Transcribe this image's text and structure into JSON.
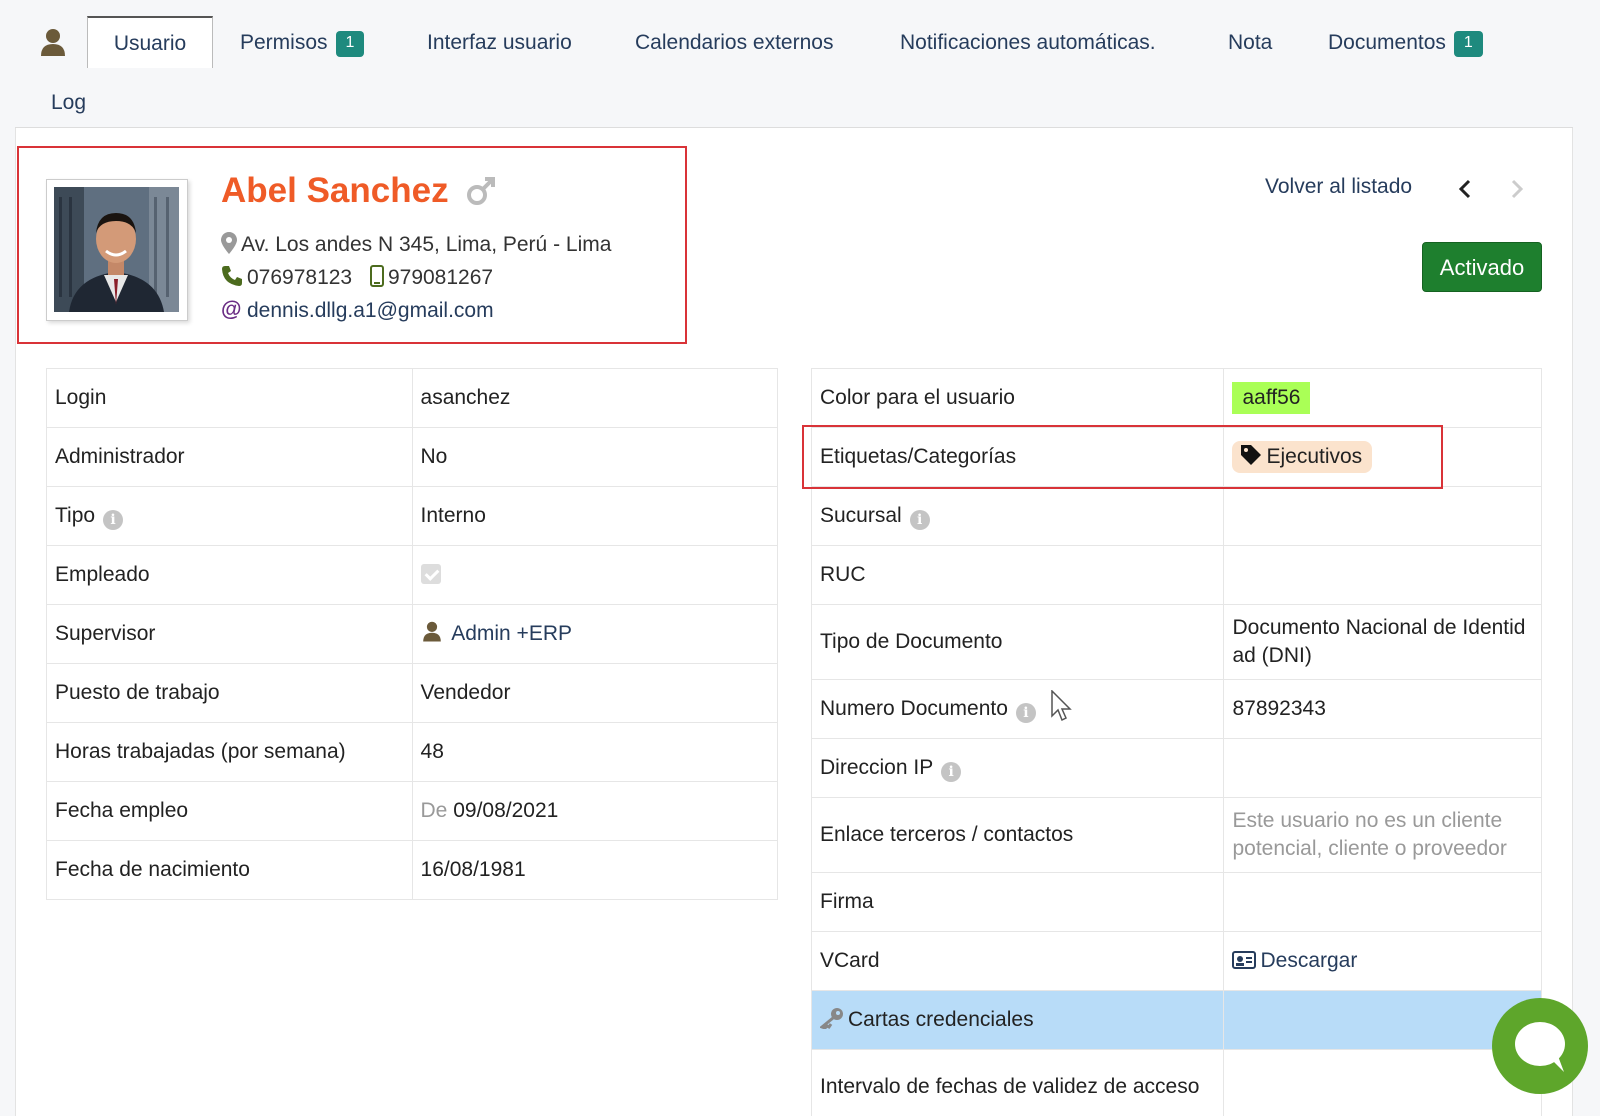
{
  "tabs": {
    "items": [
      {
        "label": "Usuario",
        "active": true
      },
      {
        "label": "Permisos",
        "badge": "1"
      },
      {
        "label": "Interfaz usuario"
      },
      {
        "label": "Calendarios externos"
      },
      {
        "label": "Notificaciones automáticas."
      },
      {
        "label": "Nota"
      },
      {
        "label": "Documentos",
        "badge": "1"
      },
      {
        "label": "Log"
      }
    ]
  },
  "profile": {
    "name": "Abel Sanchez",
    "gender_icon": "male-icon",
    "address": "Av. Los andes N 345, Lima, Perú - Lima",
    "phone": "076978123",
    "mobile": "979081267",
    "email": "dennis.dllg.a1@gmail.com"
  },
  "nav": {
    "back_label": "Volver al listado",
    "status_label": "Activado"
  },
  "left_table": {
    "rows": [
      {
        "label": "Login",
        "value": "asanchez"
      },
      {
        "label": "Administrador",
        "value": "No"
      },
      {
        "label": "Tipo",
        "value": "Interno"
      },
      {
        "label": "Empleado",
        "value": ""
      },
      {
        "label": "Supervisor",
        "value": "Admin +ERP"
      },
      {
        "label": "Puesto de trabajo",
        "value": "Vendedor"
      },
      {
        "label": "Horas trabajadas (por semana)",
        "value": "48"
      },
      {
        "label": "Fecha empleo",
        "prefix": "De",
        "value": "09/08/2021"
      },
      {
        "label": "Fecha de nacimiento",
        "value": "16/08/1981"
      }
    ]
  },
  "right_table": {
    "rows": [
      {
        "label": "Color para el usuario",
        "value": "aaff56"
      },
      {
        "label": "Etiquetas/Categorías",
        "value": "Ejecutivos"
      },
      {
        "label": "Sucursal",
        "value": ""
      },
      {
        "label": "RUC",
        "value": ""
      },
      {
        "label": "Tipo de Documento",
        "value": "Documento Nacional de Identidad (DNI)"
      },
      {
        "label": "Numero Documento",
        "value": "87892343"
      },
      {
        "label": "Direccion IP",
        "value": ""
      },
      {
        "label": "Enlace terceros / contactos",
        "value": "Este usuario no es un cliente potencial, cliente o proveedor"
      },
      {
        "label": "Firma",
        "value": ""
      },
      {
        "label": "VCard",
        "value": "Descargar"
      },
      {
        "label": "Cartas credenciales",
        "value": ""
      },
      {
        "label": "Intervalo de fechas de validez de acceso",
        "value": ""
      }
    ]
  },
  "colors": {
    "accent_name": "#ef5b27",
    "status_green": "#1e7f2e",
    "badge": "#1e8a7e",
    "user_color": "#aaff56",
    "highlight_box": "#d93338",
    "section_blue": "#b8dcf8"
  }
}
